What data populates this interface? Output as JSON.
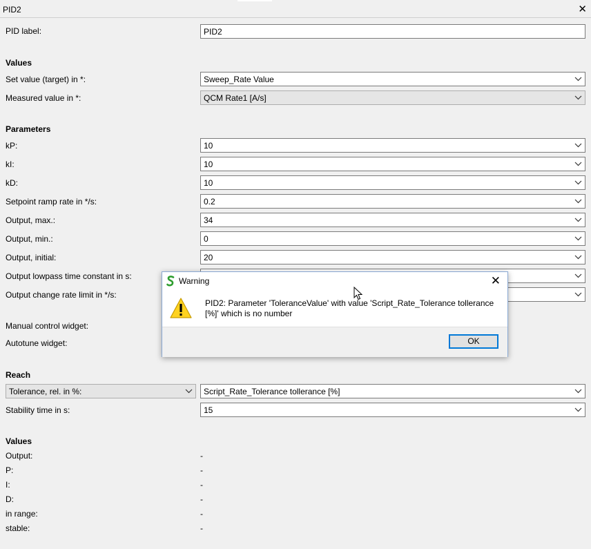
{
  "window": {
    "title": "PID2"
  },
  "pid_label": {
    "label": "PID label:",
    "value": "PID2"
  },
  "values_section": {
    "header": "Values",
    "set_value": {
      "label": "Set value (target) in *:",
      "value": "Sweep_Rate Value"
    },
    "measured_value": {
      "label": "Measured value in *:",
      "value": "QCM Rate1 [A/s]"
    }
  },
  "parameters": {
    "header": "Parameters",
    "rows": [
      {
        "label": "kP:",
        "value": "10"
      },
      {
        "label": "kI:",
        "value": "10"
      },
      {
        "label": "kD:",
        "value": "10"
      },
      {
        "label": "Setpoint ramp rate in */s:",
        "value": "0.2"
      },
      {
        "label": "Output, max.:",
        "value": "34"
      },
      {
        "label": "Output, min.:",
        "value": "0"
      },
      {
        "label": "Output, initial:",
        "value": "20"
      },
      {
        "label": "Output lowpass time constant in s:",
        "value": ""
      },
      {
        "label": "Output change rate limit in */s:",
        "value": ""
      }
    ],
    "manual_control_widget": "Manual control widget:",
    "autotune_widget": "Autotune widget:"
  },
  "reach": {
    "header": "Reach",
    "mode": "Tolerance, rel. in %:",
    "tolerance_value": "Script_Rate_Tolerance tollerance [%]",
    "stability_label": "Stability time in s:",
    "stability_value": "15"
  },
  "live_values": {
    "header": "Values",
    "rows": [
      {
        "label": "Output:",
        "value": "-"
      },
      {
        "label": "P:",
        "value": "-"
      },
      {
        "label": "I:",
        "value": "-"
      },
      {
        "label": "D:",
        "value": "-"
      },
      {
        "label": "in range:",
        "value": "-"
      },
      {
        "label": "stable:",
        "value": "-"
      }
    ]
  },
  "dialog": {
    "title": "Warning",
    "message": "PID2: Parameter 'ToleranceValue' with value 'Script_Rate_Tolerance tollerance [%]' which is no number",
    "ok_label": "OK"
  },
  "colors": {
    "accent": "#0078d7",
    "warning": "#ffd21f",
    "logo": "#2e9d2e"
  }
}
